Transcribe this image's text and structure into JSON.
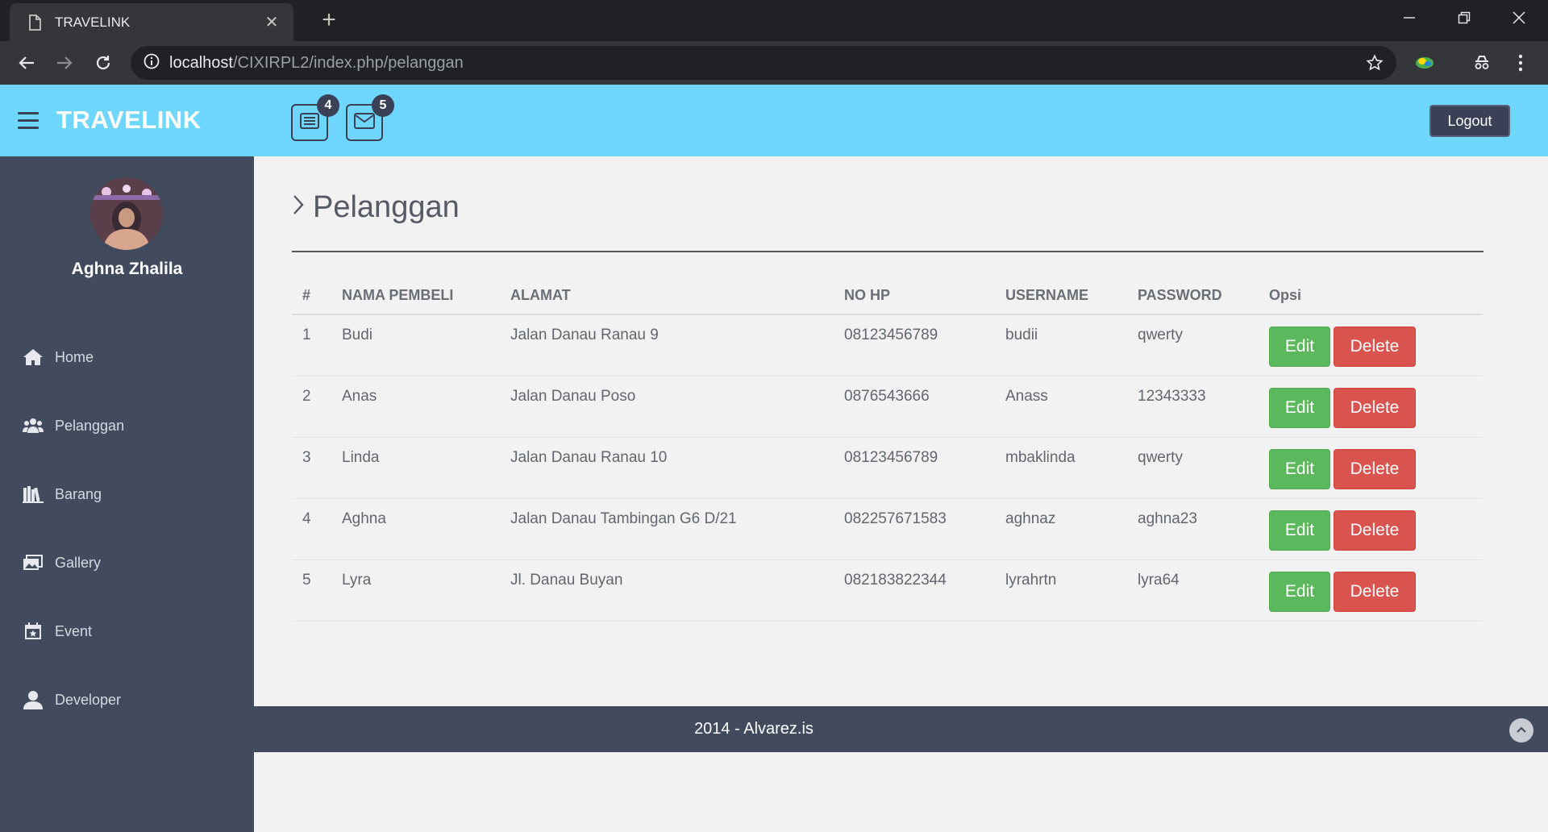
{
  "browser": {
    "tab_title": "TRAVELINK",
    "url_host": "localhost",
    "url_path": "/CIXIRPL2/index.php/pelanggan"
  },
  "header": {
    "brand": "TRAVELINK",
    "tasks_badge": "4",
    "mail_badge": "5",
    "logout_label": "Logout"
  },
  "sidebar": {
    "user_name": "Aghna Zhalila",
    "items": [
      {
        "label": "Home",
        "icon": "home-icon"
      },
      {
        "label": "Pelanggan",
        "icon": "users-icon"
      },
      {
        "label": "Barang",
        "icon": "books-icon"
      },
      {
        "label": "Gallery",
        "icon": "gallery-icon"
      },
      {
        "label": "Event",
        "icon": "calendar-icon"
      },
      {
        "label": "Developer",
        "icon": "user-icon"
      }
    ]
  },
  "main": {
    "title": "Pelanggan",
    "columns": [
      "#",
      "NAMA PEMBELI",
      "ALAMAT",
      "NO HP",
      "USERNAME",
      "PASSWORD",
      "Opsi"
    ],
    "rows": [
      {
        "no": "1",
        "nama": "Budi",
        "alamat": "Jalan Danau Ranau 9",
        "hp": "08123456789",
        "username": "budii",
        "password": "qwerty"
      },
      {
        "no": "2",
        "nama": "Anas",
        "alamat": "Jalan Danau Poso",
        "hp": "0876543666",
        "username": "Anass",
        "password": "12343333"
      },
      {
        "no": "3",
        "nama": "Linda",
        "alamat": "Jalan Danau Ranau 10",
        "hp": "08123456789",
        "username": "mbaklinda",
        "password": "qwerty"
      },
      {
        "no": "4",
        "nama": "Aghna",
        "alamat": "Jalan Danau Tambingan G6 D/21",
        "hp": "082257671583",
        "username": "aghnaz",
        "password": "aghna23"
      },
      {
        "no": "5",
        "nama": "Lyra",
        "alamat": "Jl. Danau Buyan",
        "hp": "082183822344",
        "username": "lyrahrtn",
        "password": "lyra64"
      }
    ],
    "edit_label": "Edit",
    "delete_label": "Delete"
  },
  "footer": {
    "text": "2014 - Alvarez.is"
  },
  "colors": {
    "header_bg": "#6fd6fe",
    "sidebar_bg": "#424a5d",
    "edit_green": "#5cb85c",
    "delete_red": "#d9534f"
  }
}
